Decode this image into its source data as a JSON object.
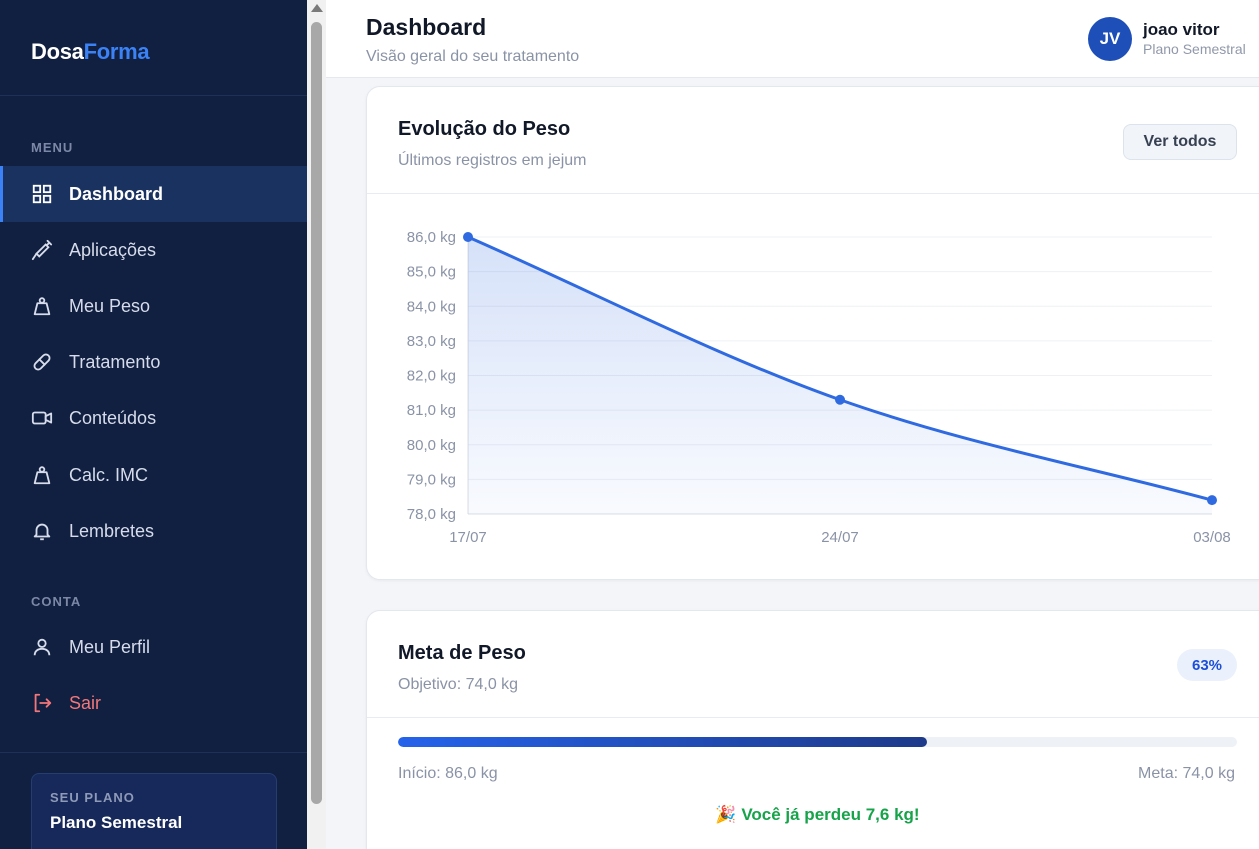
{
  "brand": {
    "part1": "Dosa",
    "part2": "Forma"
  },
  "sidebar": {
    "menu_label": "MENU",
    "menu_items": [
      {
        "label": "Dashboard",
        "icon": "grid-icon",
        "active": true
      },
      {
        "label": "Aplicações",
        "icon": "syringe-icon",
        "active": false
      },
      {
        "label": "Meu Peso",
        "icon": "scale-weight-icon",
        "active": false
      },
      {
        "label": "Tratamento",
        "icon": "pill-icon",
        "active": false
      },
      {
        "label": "Conteúdos",
        "icon": "video-icon",
        "active": false
      },
      {
        "label": "Calc. IMC",
        "icon": "weight-icon",
        "active": false
      },
      {
        "label": "Lembretes",
        "icon": "bell-icon",
        "active": false
      }
    ],
    "account_label": "CONTA",
    "account_items": [
      {
        "label": "Meu Perfil",
        "icon": "user-icon"
      },
      {
        "label": "Sair",
        "icon": "logout-icon"
      }
    ],
    "plan_label": "SEU PLANO",
    "plan_name": "Plano Semestral"
  },
  "header": {
    "title": "Dashboard",
    "subtitle": "Visão geral do seu tratamento",
    "avatar_initials": "JV",
    "user_name": "joao vitor",
    "user_plan": "Plano Semestral"
  },
  "weight_card": {
    "title": "Evolução do Peso",
    "subtitle": "Últimos registros em jejum",
    "button_label": "Ver todos"
  },
  "chart_data": {
    "type": "area",
    "x": [
      "17/07",
      "24/07",
      "03/08"
    ],
    "values": [
      86.0,
      81.3,
      78.4
    ],
    "ylim": [
      78,
      86
    ],
    "yticks": [
      "86,0 kg",
      "85,0 kg",
      "84,0 kg",
      "83,0 kg",
      "82,0 kg",
      "81,0 kg",
      "80,0 kg",
      "79,0 kg",
      "78,0 kg"
    ],
    "color": "#2f6ae0",
    "grid": true
  },
  "goal_card": {
    "title": "Meta de Peso",
    "subtitle": "Objetivo: 74,0 kg",
    "percent_label": "63%",
    "progress": 0.63,
    "start_label": "Início: 86,0 kg",
    "goal_label": "Meta: 74,0 kg",
    "lost_emoji": "🎉",
    "lost_message": "Você já perdeu 7,6 kg!"
  },
  "colors": {
    "sidebar_bg": "#111f40",
    "accent": "#3b82f6",
    "danger": "#f2777a",
    "success": "#16a34a"
  }
}
